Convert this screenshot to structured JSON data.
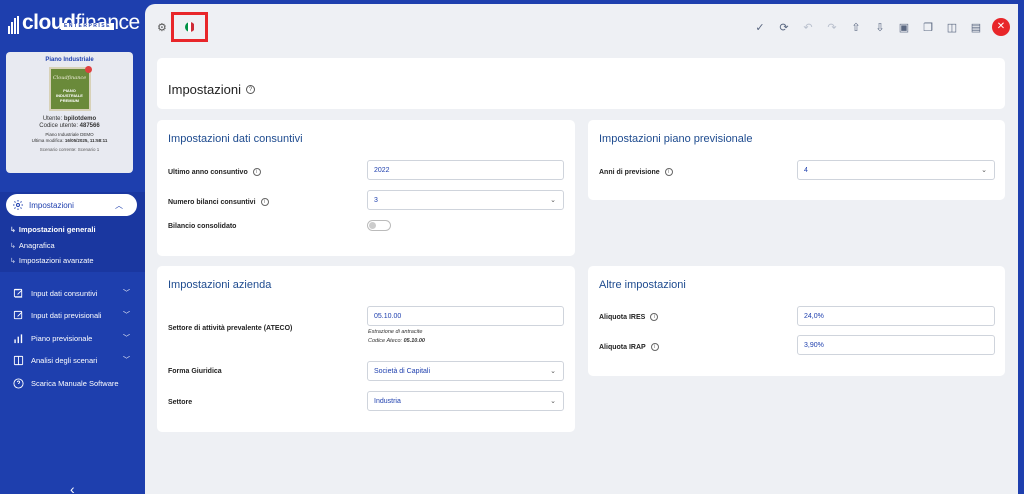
{
  "sidebar": {
    "logo_bold": "cloud",
    "logo_light": "finance",
    "logo_sub": "ENTERPRISE",
    "plan": {
      "title": "Piano Industriale",
      "image_title": "Cloudfinance",
      "image_line1": "PIANO",
      "image_line2": "INDUSTRIALE",
      "image_line3": "PREMIUM",
      "user_label": "Utente:",
      "user_value": "bpilotdemo",
      "code_label": "Codice utente:",
      "code_value": "487566",
      "plan_name": "Piano Industriale DEMO",
      "last_mod_label": "Ultima modifica:",
      "last_mod_value": "16/05/2025, 11:58:11",
      "scenario": "Scenario corrente: Scenario 1"
    },
    "active_menu": "Impostazioni",
    "sub_items": [
      {
        "label": "Impostazioni generali"
      },
      {
        "label": "Anagrafica"
      },
      {
        "label": "Impostazioni avanzate"
      }
    ],
    "nav": [
      {
        "label": "Input dati consuntivi"
      },
      {
        "label": "Input dati previsionali"
      },
      {
        "label": "Piano previsionale"
      },
      {
        "label": "Analisi degli scenari"
      },
      {
        "label": "Scarica Manuale Software"
      }
    ]
  },
  "header": {
    "title": "Impostazioni",
    "flag_colors": [
      "#009246",
      "#ffffff",
      "#ce2b37"
    ]
  },
  "consuntivi": {
    "title": "Impostazioni dati consuntivi",
    "ultimo_anno_label": "Ultimo anno consuntivo",
    "ultimo_anno_value": "2022",
    "numero_bilanci_label": "Numero bilanci consuntivi",
    "numero_bilanci_value": "3",
    "bilancio_consolidato_label": "Bilancio consolidato"
  },
  "previsionale": {
    "title": "Impostazioni piano previsionale",
    "anni_label": "Anni di previsione",
    "anni_value": "4"
  },
  "azienda": {
    "title": "Impostazioni azienda",
    "ateco_label": "Settore di attività prevalente (ATECO)",
    "ateco_value": "05.10.00",
    "ateco_desc": "Estrazione di antracite",
    "ateco_code_label": "Codice Ateco:",
    "ateco_code_value": "05.10.00",
    "forma_label": "Forma Giuridica",
    "forma_value": "Società di Capitali",
    "settore_label": "Settore",
    "settore_value": "Industria"
  },
  "altre": {
    "title": "Altre impostazioni",
    "ires_label": "Aliquota IRES",
    "ires_value": "24,0%",
    "irap_label": "Aliquota IRAP",
    "irap_value": "3,90%"
  }
}
